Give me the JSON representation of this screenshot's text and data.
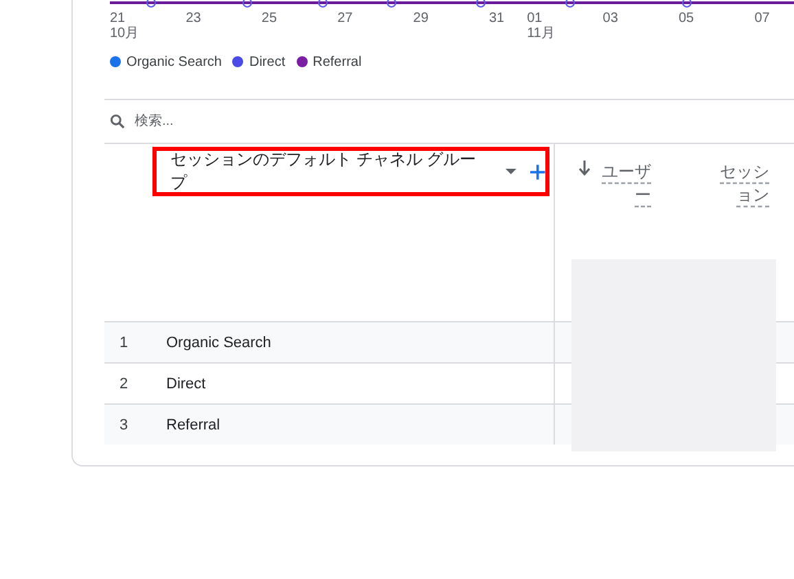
{
  "chart": {
    "x_axis_labels": [
      {
        "day": "21",
        "month": "10月"
      },
      {
        "day": "23"
      },
      {
        "day": "25"
      },
      {
        "day": "27"
      },
      {
        "day": "29"
      },
      {
        "day": "31"
      },
      {
        "day": "01",
        "month": "11月"
      },
      {
        "day": "03"
      },
      {
        "day": "05"
      },
      {
        "day": "07"
      }
    ],
    "legend": [
      {
        "label": "Organic Search",
        "color": "#1a73e8"
      },
      {
        "label": "Direct",
        "color": "#4a4ae6"
      },
      {
        "label": "Referral",
        "color": "#7b1fa2"
      }
    ]
  },
  "search": {
    "placeholder": "検索..."
  },
  "table": {
    "dimension_header": {
      "label": "セッションのデフォルト チャネル グループ",
      "highlighted": true
    },
    "metric_columns": [
      {
        "label": "ユーザー",
        "sorted": true
      },
      {
        "label": "セッション",
        "sorted": false
      }
    ],
    "rows": [
      {
        "rank": "1",
        "name": "Organic Search"
      },
      {
        "rank": "2",
        "name": "Direct"
      },
      {
        "rank": "3",
        "name": "Referral"
      }
    ]
  }
}
